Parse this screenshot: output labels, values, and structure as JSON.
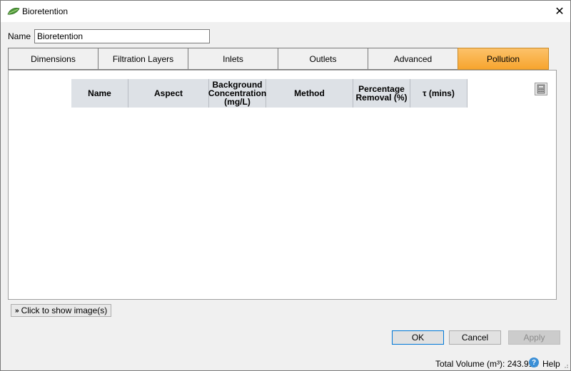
{
  "window": {
    "title": "Bioretention",
    "close_glyph": "✕",
    "icon": "leaf-icon"
  },
  "name_field": {
    "label": "Name",
    "value": "Bioretention"
  },
  "tabs": [
    {
      "label": "Dimensions",
      "active": false
    },
    {
      "label": "Filtration Layers",
      "active": false
    },
    {
      "label": "Inlets",
      "active": false
    },
    {
      "label": "Outlets",
      "active": false
    },
    {
      "label": "Advanced",
      "active": false
    },
    {
      "label": "Pollution",
      "active": true
    }
  ],
  "pollution_table": {
    "columns": [
      "Name",
      "Aspect",
      "Background Concentration (mg/L)",
      "Method",
      "Percentage Removal (%)",
      "τ (mins)"
    ],
    "rows": []
  },
  "calculator_icon": "calculator-icon",
  "show_images_button": {
    "label": "Click to show image(s)",
    "icon": "double-chevron-down-icon"
  },
  "buttons": {
    "ok": "OK",
    "cancel": "Cancel",
    "apply": "Apply"
  },
  "status_bar": {
    "total_volume": "Total Volume (m³): 243.911",
    "help": "Help"
  },
  "colors": {
    "active_tab": "#f7a52e",
    "header_bg": "#dde1e6",
    "help_icon": "#3b8fd6"
  }
}
